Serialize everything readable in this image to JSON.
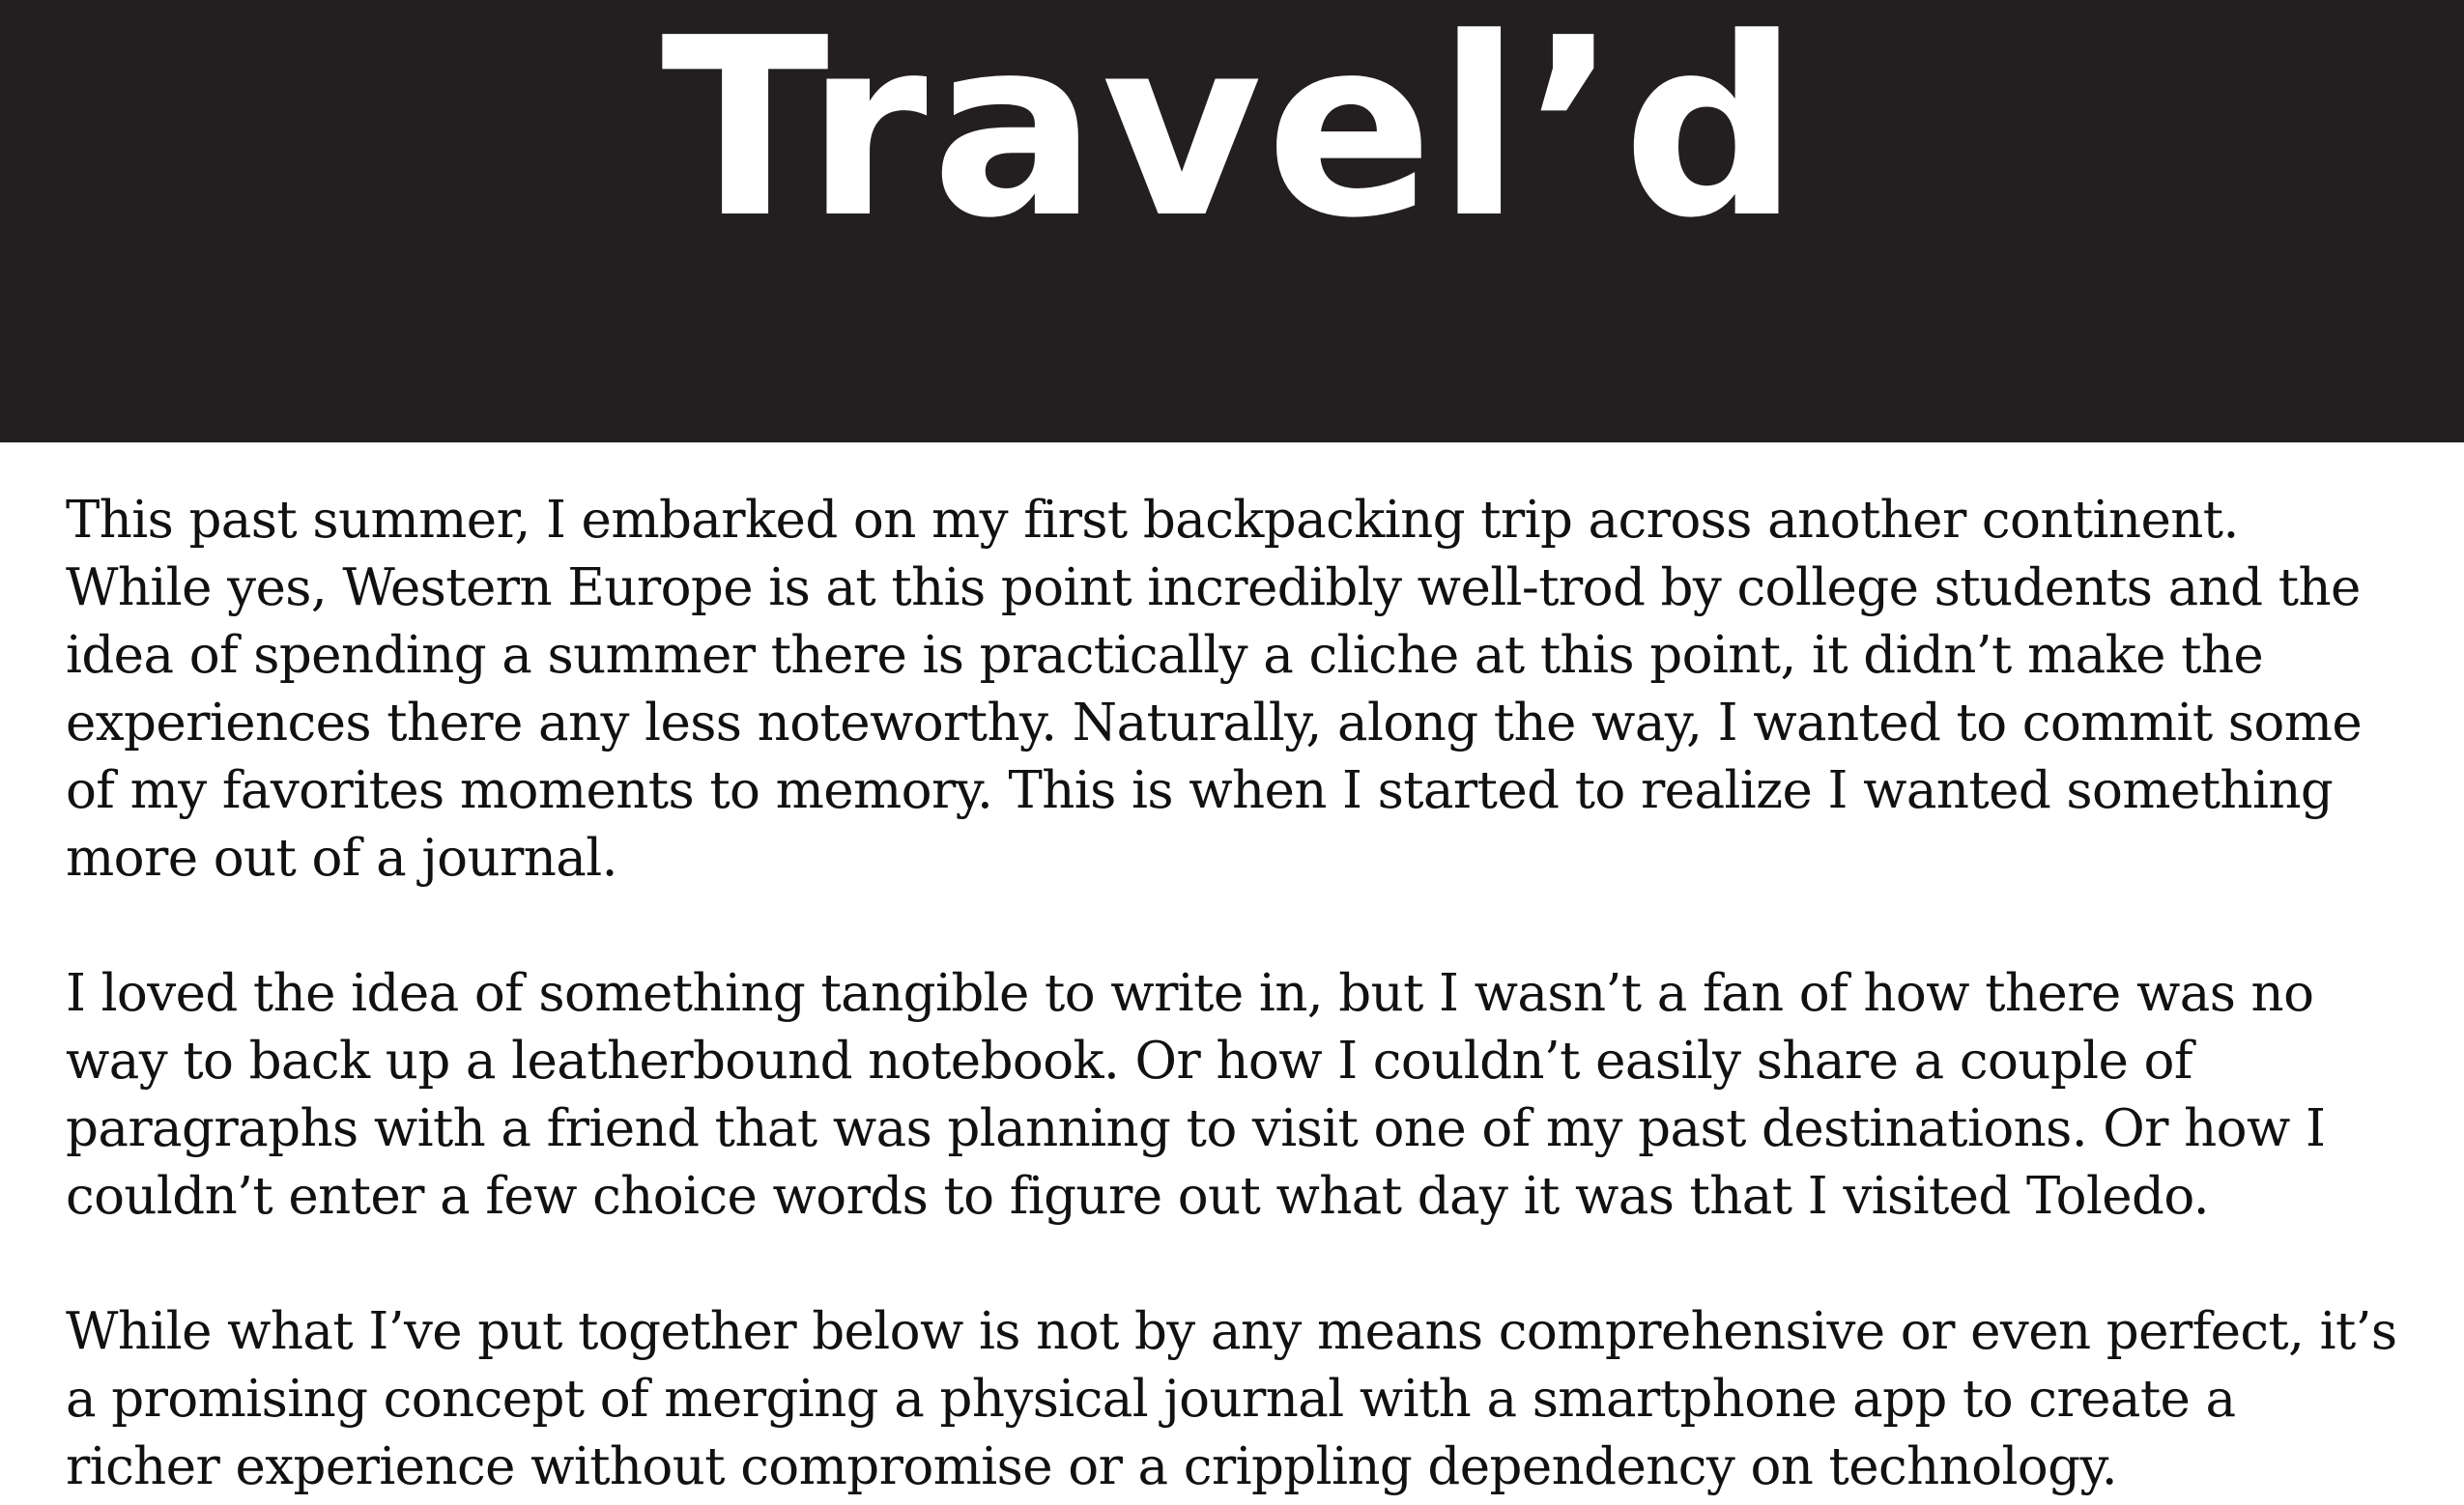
{
  "header": {
    "title": "Travel’d"
  },
  "body": {
    "paragraphs": [
      "This past summer, I embarked on my first backpacking trip across another continent. While yes, Western Europe is at this point incredibly well-trod by college students and the idea of spending a summer there is practically a cliche at this point, it didn’t make the experiences there any less noteworthy. Naturally, along the way, I wanted to commit some of my favorites moments to memory. This is when I started to realize I wanted something more out of a journal.",
      "I loved the idea of something tangible to write in, but I wasn’t a fan of how there was no way to back up a leatherbound notebook. Or how I couldn’t easily share a couple of paragraphs with a friend that was planning to visit one of my past destinations. Or how I couldn’t enter a few choice words to figure out what day it was that I visited Toledo.",
      "While what I’ve put together below is not by any means comprehensive or even perfect, it’s a promising concept of merging a physical journal with a smartphone app to create a richer experience without compromise or a crippling dependency on technology."
    ]
  },
  "colors": {
    "header_background": "#231f20",
    "title_text": "#ffffff",
    "body_text": "#111111",
    "page_background": "#ffffff"
  }
}
